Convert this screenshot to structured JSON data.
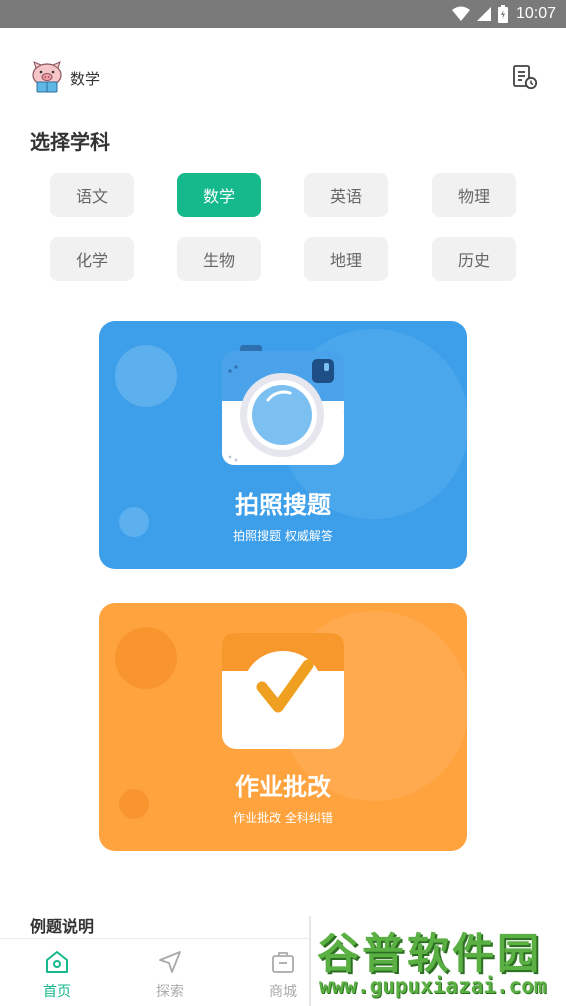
{
  "status_bar": {
    "time": "10:07"
  },
  "header": {
    "current_subject": "数学"
  },
  "subjects_section": {
    "title": "选择学科",
    "selected": "数学",
    "items": [
      "语文",
      "数学",
      "英语",
      "物理",
      "化学",
      "生物",
      "地理",
      "历史"
    ]
  },
  "features": [
    {
      "title": "拍照搜题",
      "subtitle": "拍照搜题 权威解答",
      "color": "#3d9fea"
    },
    {
      "title": "作业批改",
      "subtitle": "作业批改 全科纠错",
      "color": "#ffa33f"
    }
  ],
  "examples": {
    "title": "例题说明"
  },
  "bottom_nav": {
    "active": "首页",
    "items": [
      {
        "label": "首页",
        "icon": "home-icon"
      },
      {
        "label": "探索",
        "icon": "navigation-arrow-icon"
      },
      {
        "label": "商城",
        "icon": "shop-bag-icon"
      }
    ]
  },
  "watermark": {
    "title": "谷普软件园",
    "url": "www.gupuxiazai.com"
  },
  "colors": {
    "accent": "#15b98b",
    "photo_card": "#3d9fea",
    "homework_card": "#ffa33f"
  }
}
